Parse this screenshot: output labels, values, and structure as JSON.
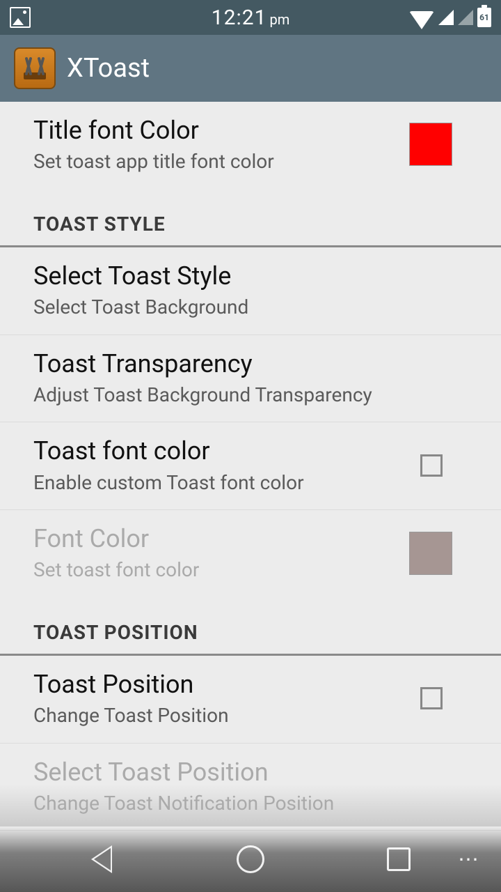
{
  "status": {
    "time": "12:21",
    "ampm": "pm",
    "battery": "61"
  },
  "app": {
    "title": "XToast"
  },
  "rows": {
    "title_font_color": {
      "title": "Title font Color",
      "sub": "Set toast app title font color",
      "swatch": "#ff0000"
    },
    "select_style": {
      "title": "Select Toast Style",
      "sub": "Select Toast Background"
    },
    "transparency": {
      "title": "Toast Transparency",
      "sub": "Adjust Toast Background Transparency"
    },
    "toast_font_color_enable": {
      "title": "Toast font color",
      "sub": "Enable custom Toast font color"
    },
    "font_color": {
      "title": "Font Color",
      "sub": "Set toast font color",
      "swatch": "#a69693"
    },
    "toast_position_enable": {
      "title": "Toast Position",
      "sub": "Change Toast Position"
    },
    "select_position": {
      "title": "Select Toast Position",
      "sub": "Change Toast Notification Position"
    }
  },
  "sections": {
    "style": "TOAST STYLE",
    "position": "TOAST POSITION"
  }
}
